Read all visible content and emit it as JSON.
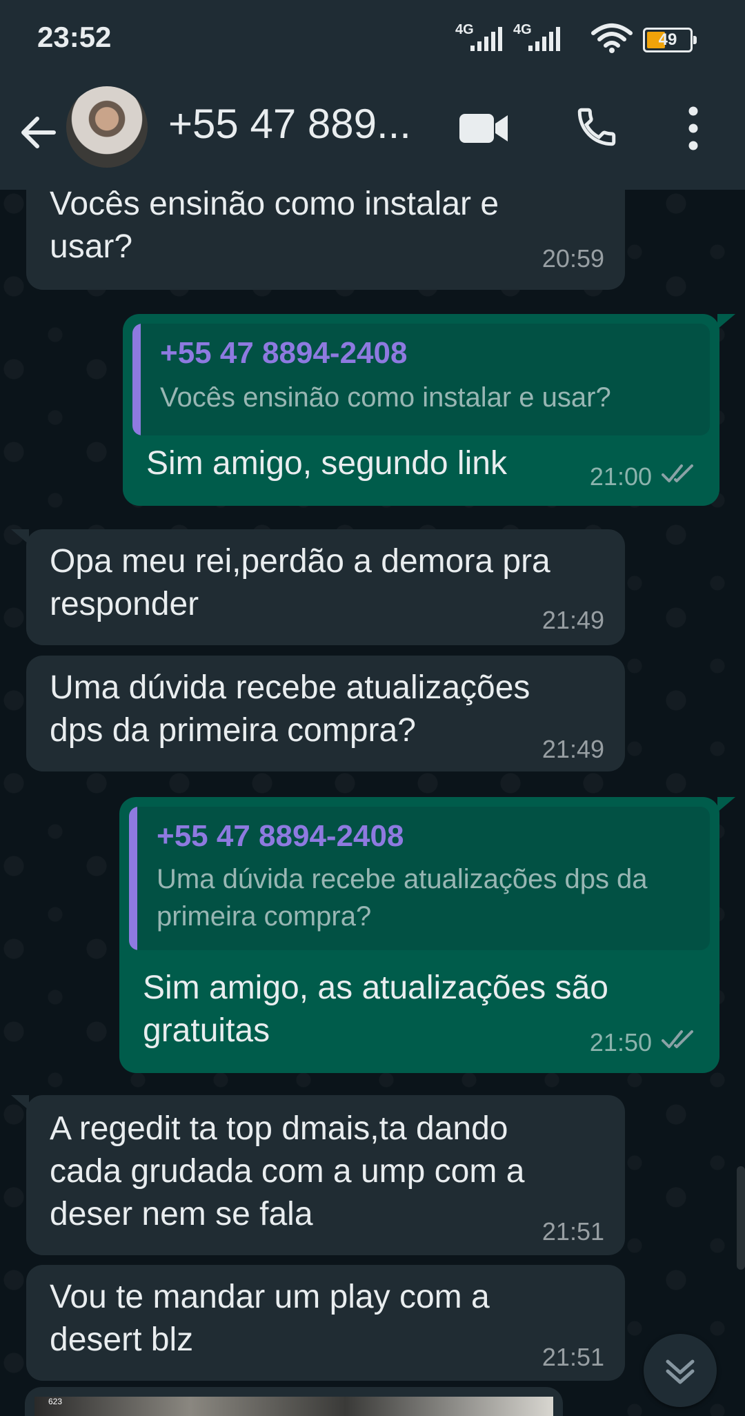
{
  "status_bar": {
    "time": "23:52",
    "network_1": "4G",
    "network_2": "4G",
    "battery": "49",
    "battery_level_percent": 49
  },
  "header": {
    "contact_name": "+55 47 889...",
    "icons": [
      "back-arrow-icon",
      "video-call-icon",
      "phone-icon",
      "more-vert-icon"
    ]
  },
  "colors": {
    "incoming_bubble": "#202c33",
    "outgoing_bubble": "#005c4b",
    "quote_author": "#8e7ae0",
    "background": "#0b141a",
    "header": "#1f2c34"
  },
  "messages": [
    {
      "direction": "in",
      "text": "Vocês ensinão como instalar e\nusar?",
      "time": "20:59"
    },
    {
      "direction": "out",
      "quote_author": "+55 47 8894-2408",
      "quote_text": "Vocês ensinão como instalar e usar?",
      "text": "Sim amigo, segundo link",
      "time": "21:00",
      "status": "read"
    },
    {
      "direction": "in",
      "text": "Opa meu rei,perdão a demora pra\nresponder",
      "time": "21:49"
    },
    {
      "direction": "in",
      "text": "Uma dúvida recebe atualizações\ndps da primeira compra?",
      "time": "21:49"
    },
    {
      "direction": "out",
      "quote_author": "+55 47 8894-2408",
      "quote_text": "Uma dúvida recebe atualizações dps\nda primeira compra?",
      "text": "Sim amigo, as atualizações são\ngratuitas",
      "time": "21:50",
      "status": "read"
    },
    {
      "direction": "in",
      "text": "A regedit ta top dmais,ta dando\ncada grudada com a ump com a\ndeser nem se fala",
      "time": "21:51"
    },
    {
      "direction": "in",
      "text": "Vou te mandar um play com a\ndesert blz",
      "time": "21:51"
    }
  ],
  "media_preview_label": "623"
}
